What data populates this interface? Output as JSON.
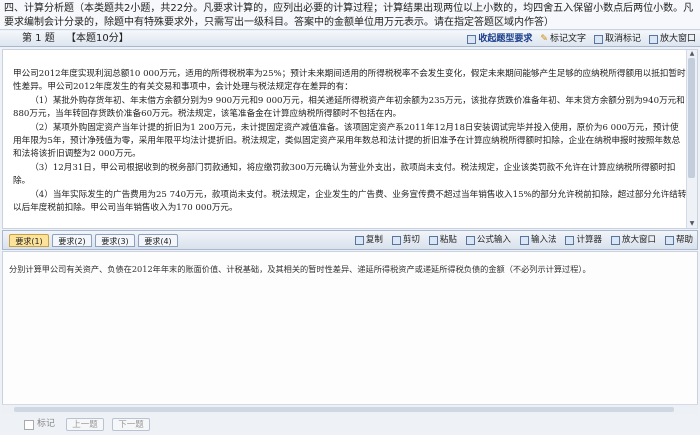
{
  "instructions": "四、计算分析题（本类题共2小题，共22分。凡要求计算的，应列出必要的计算过程；计算结果出现两位以上小数的，均四舍五入保留小数点后两位小数。凡要求编制会计分录的，除题中有特殊要求外，只需写出一级科目。答案中的金额单位用万元表示。请在指定答题区域内作答）",
  "question": {
    "number_label": "第 1 题",
    "score_label": "【本题10分】",
    "tools": [
      {
        "label": "收起题型要求",
        "icon": "collapse-icon"
      },
      {
        "label": "标记文字",
        "icon": "highlight-icon"
      },
      {
        "label": "取消标记",
        "icon": "unmark-icon"
      },
      {
        "label": "放大窗口",
        "icon": "enlarge-icon"
      }
    ],
    "paragraphs": [
      "甲公司2012年度实现利润总额10 000万元，适用的所得税税率为25%；预计未来期间适用的所得税税率不会发生变化，假定未来期间能够产生足够的应纳税所得额用以抵扣暂时性差异。甲公司2012年度发生的有关交易和事项中，会计处理与税法规定存在差异的有：",
      "（1）某批外购存货年初、年末借方余额分别为9 900万元和9 000万元，相关递延所得税资产年初余额为235万元，该批存货跌价准备年初、年末贷方余额分别为940万元和880万元，当年转回存货跌价准备60万元。税法规定，该笔准备金在计算应纳税所得额时不包括在内。",
      "（2）某项外购固定资产当年计提的折旧为1 200万元，未计提固定资产减值准备。该项固定资产系2011年12月18日安装调试完毕并投入使用，原价为6 000万元，预计使用年限为5年，预计净残值为零，采用年限平均法计提折旧。税法规定，类似固定资产采用年数总和法计提的折旧准予在计算应纳税所得额时扣除，企业在纳税申报时按照年数总和法将该折旧调整为2 000万元。",
      "（3）12月31日，甲公司根据收到的税务部门罚款通知，将应缴罚款300万元确认为营业外支出，款项尚未支付。税法规定，企业该类罚款不允许在计算应纳税所得额时扣除。",
      "（4）当年实际发生的广告费用为25 740万元，款项尚未支付。税法规定，企业发生的广告费、业务宣传费不超过当年销售收入15%的部分允许税前扣除，超过部分允许结转以后年度税前扣除。甲公司当年销售收入为170 000万元。"
    ]
  },
  "answer_tabs": [
    "要求(1)",
    "要求(2)",
    "要求(3)",
    "要求(4)"
  ],
  "editor_tools": [
    {
      "label": "复制",
      "icon": "copy-icon"
    },
    {
      "label": "剪切",
      "icon": "cut-icon"
    },
    {
      "label": "粘贴",
      "icon": "paste-icon"
    },
    {
      "label": "公式输入",
      "icon": "formula-icon"
    },
    {
      "label": "输入法",
      "icon": "ime-icon"
    },
    {
      "label": "计算器",
      "icon": "calculator-icon"
    },
    {
      "label": "放大窗口",
      "icon": "enlarge-icon"
    },
    {
      "label": "帮助",
      "icon": "help-icon"
    }
  ],
  "answer_prompt": "分别计算甲公司有关资产、负债在2012年年末的账面价值、计税基础，及其相关的暂时性差异、递延所得税资产或递延所得税负债的金额（不必列示计算过程）。",
  "footer": {
    "mark_label": "标记",
    "prev_label": "上一题",
    "next_label": "下一题"
  },
  "colors": {
    "active_tab": "#fde39a",
    "accent": "#5875a0"
  }
}
